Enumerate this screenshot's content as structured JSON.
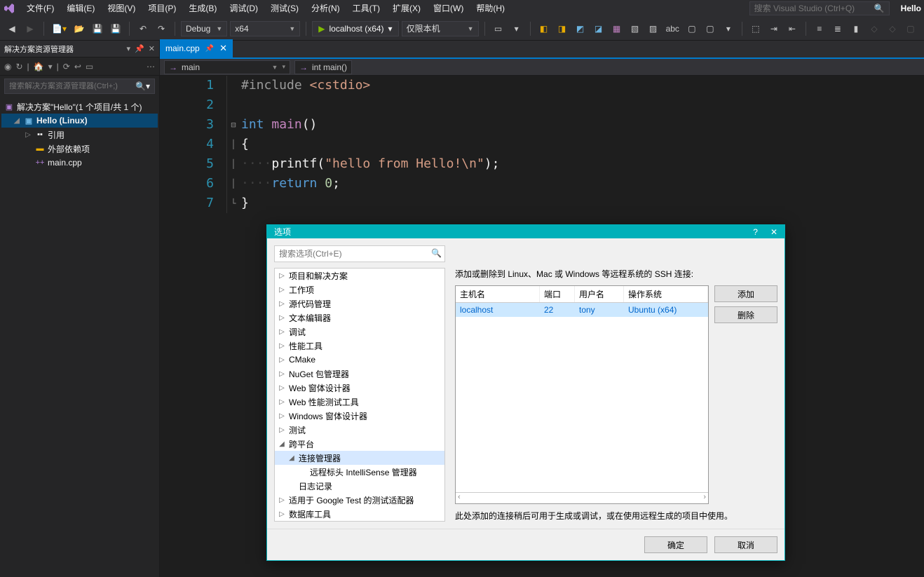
{
  "app_title": "Hello",
  "menu": [
    "文件(F)",
    "编辑(E)",
    "视图(V)",
    "项目(P)",
    "生成(B)",
    "调试(D)",
    "测试(S)",
    "分析(N)",
    "工具(T)",
    "扩展(X)",
    "窗口(W)",
    "帮助(H)"
  ],
  "global_search_placeholder": "搜索 Visual Studio (Ctrl+Q)",
  "toolbar": {
    "config": "Debug",
    "platform": "x64",
    "run_target": "localhost (x64)",
    "scope": "仅限本机"
  },
  "solution_panel": {
    "title": "解决方案资源管理器",
    "search_placeholder": "搜索解决方案资源管理器(Ctrl+;)",
    "root": "解决方案\"Hello\"(1 个项目/共 1 个)",
    "project": "Hello (Linux)",
    "refs": "引用",
    "external": "外部依赖项",
    "file": "main.cpp"
  },
  "editor": {
    "tab": "main.cpp",
    "crumb_scope": "main",
    "crumb_func": "int main()",
    "lines": {
      "l1": {
        "inc": "#include ",
        "hdr": "<cstdio>"
      },
      "l3": {
        "kw": "int ",
        "fn": "main",
        "paren": "()"
      },
      "l4": "{",
      "l5": {
        "pre": "    ",
        "call": "printf(",
        "str": "\"hello from Hello!\\n\"",
        "end": ");"
      },
      "l6": {
        "pre": "    ",
        "kw": "return ",
        "num": "0",
        "end": ";"
      },
      "l7": "}"
    }
  },
  "dialog": {
    "title": "选项",
    "search_placeholder": "搜索选项(Ctrl+E)",
    "tree": [
      "项目和解决方案",
      "工作项",
      "源代码管理",
      "文本编辑器",
      "调试",
      "性能工具",
      "CMake",
      "NuGet 包管理器",
      "Web 窗体设计器",
      "Web 性能测试工具",
      "Windows 窗体设计器",
      "测试",
      "跨平台",
      "连接管理器",
      "远程标头 IntelliSense 管理器",
      "日志记录",
      "适用于 Google Test 的测试适配器",
      "数据库工具"
    ],
    "desc": "添加或删除到 Linux、Mac 或 Windows 等远程系统的 SSH 连接:",
    "table": {
      "headers": {
        "host": "主机名",
        "port": "端口",
        "user": "用户名",
        "os": "操作系统"
      },
      "row": {
        "host": "localhost",
        "port": "22",
        "user": "tony",
        "os": "Ubuntu (x64)"
      }
    },
    "buttons": {
      "add": "添加",
      "remove": "删除",
      "ok": "确定",
      "cancel": "取消"
    },
    "note": "此处添加的连接稍后可用于生成或调试，或在使用远程生成的项目中使用。"
  }
}
